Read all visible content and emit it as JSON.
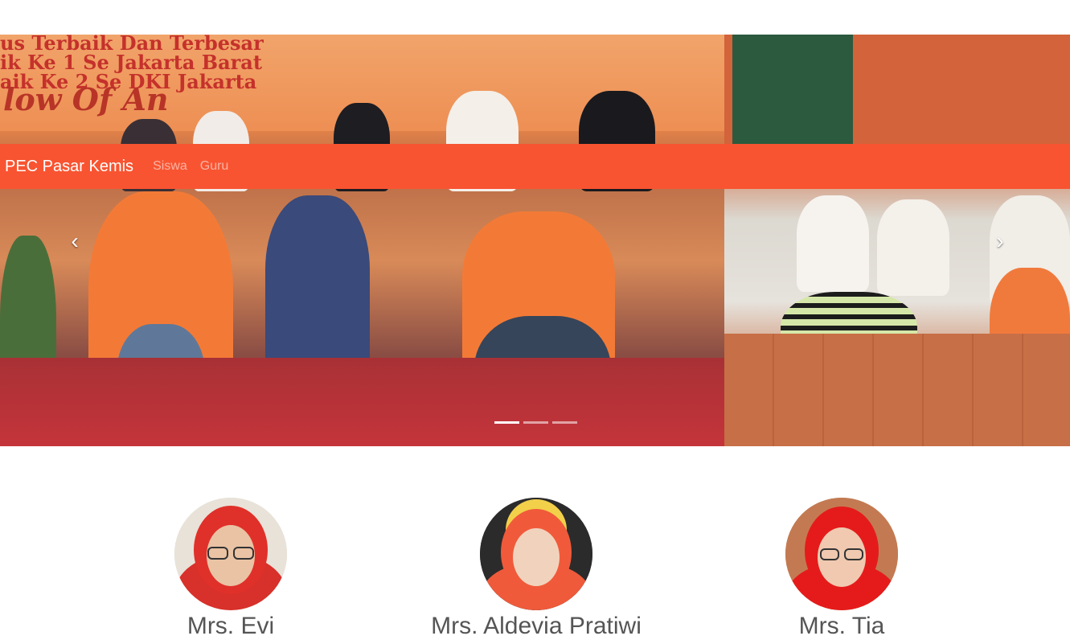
{
  "navbar": {
    "brand": "PEC Pasar Kemis",
    "links": [
      {
        "label": "Siswa"
      },
      {
        "label": "Guru"
      }
    ],
    "background_color": "#f85431"
  },
  "carousel": {
    "slide_banner_lines": [
      "us Terbaik Dan Terbesar",
      "ik Ke 1 Se Jakarta Barat",
      "aik Ke 2 Se DKI Jakarta"
    ],
    "slide_banner_script": "low Of An",
    "prev_icon": "chevron-left-icon",
    "next_icon": "chevron-right-icon",
    "prev_label": "Previous",
    "next_label": "Next",
    "indicators": [
      {
        "active": true
      },
      {
        "active": false
      },
      {
        "active": false
      }
    ]
  },
  "teachers": [
    {
      "name": "Mrs. Evi",
      "hijab_color": "#e0302a"
    },
    {
      "name": "Mrs. Aldevia Pratiwi",
      "hijab_color": "#f05a3a"
    },
    {
      "name": "Mrs. Tia",
      "hijab_color": "#e51b1b"
    }
  ]
}
